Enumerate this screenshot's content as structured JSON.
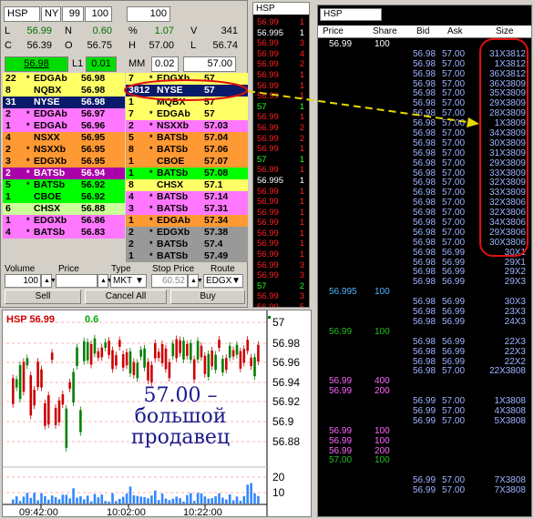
{
  "level2": {
    "symbol": "HSP",
    "exchange": "NY",
    "lot_field": "99",
    "size_field": "100",
    "volume_field": "100",
    "quote": [
      {
        "label": "L",
        "value": "56.99"
      },
      {
        "label": "N",
        "value": "0.60"
      },
      {
        "label": "%",
        "value": "1.07"
      },
      {
        "label": "V",
        "value": "341"
      },
      {
        "label": "C",
        "value": "56.39"
      },
      {
        "label": "O",
        "value": "56.75"
      },
      {
        "label": "H",
        "value": "57.00"
      },
      {
        "label": "L",
        "value": "56.74"
      }
    ],
    "bid_box": "56.98",
    "l1_label": "L1",
    "l1_value": "0.01",
    "mm_label": "MM",
    "mm_value": "0.02",
    "ask_box": "57.00",
    "bids": [
      {
        "size": "22",
        "star": "*",
        "mm": "EDGAb",
        "price": "56.98",
        "color": "#ffff66"
      },
      {
        "size": "8",
        "star": "",
        "mm": "NQBX",
        "price": "56.98",
        "color": "#ffff66"
      },
      {
        "size": "31",
        "star": "",
        "mm": "NYSE",
        "price": "56.98",
        "color": "#0a1a6a"
      },
      {
        "size": "2",
        "star": "*",
        "mm": "EDGAb",
        "price": "56.97",
        "color": "#ff77ff"
      },
      {
        "size": "1",
        "star": "*",
        "mm": "EDGAb",
        "price": "56.96",
        "color": "#ff77ff"
      },
      {
        "size": "4",
        "star": "",
        "mm": "NSXX",
        "price": "56.95",
        "color": "#ff9933"
      },
      {
        "size": "2",
        "star": "*",
        "mm": "NSXXb",
        "price": "56.95",
        "color": "#ff9933"
      },
      {
        "size": "3",
        "star": "*",
        "mm": "EDGXb",
        "price": "56.95",
        "color": "#ff9933"
      },
      {
        "size": "2",
        "star": "*",
        "mm": "BATSb",
        "price": "56.94",
        "color": "#aa00aa"
      },
      {
        "size": "5",
        "star": "*",
        "mm": "BATSb",
        "price": "56.92",
        "color": "#00ff00"
      },
      {
        "size": "1",
        "star": "",
        "mm": "CBOE",
        "price": "56.92",
        "color": "#00ff00"
      },
      {
        "size": "6",
        "star": "",
        "mm": "CHSX",
        "price": "56.88",
        "color": "#ccff99"
      },
      {
        "size": "1",
        "star": "*",
        "mm": "EDGXb",
        "price": "56.86",
        "color": "#ff77ff"
      },
      {
        "size": "4",
        "star": "*",
        "mm": "BATSb",
        "price": "56.83",
        "color": "#ff77ff"
      }
    ],
    "asks": [
      {
        "size": "7",
        "star": "*",
        "mm": "EDGXb",
        "price": "57",
        "color": "#ffff66"
      },
      {
        "size": "3812",
        "star": "",
        "mm": "NYSE",
        "price": "57",
        "color": "#0a1a6a"
      },
      {
        "size": "1",
        "star": "",
        "mm": "MQBX",
        "price": "57",
        "color": "#ffff66"
      },
      {
        "size": "7",
        "star": "*",
        "mm": "EDGAb",
        "price": "57",
        "color": "#ffff66"
      },
      {
        "size": "2",
        "star": "*",
        "mm": "NSXXb",
        "price": "57.03",
        "color": "#ff77ff"
      },
      {
        "size": "5",
        "star": "*",
        "mm": "BATSb",
        "price": "57.04",
        "color": "#ff9933"
      },
      {
        "size": "8",
        "star": "*",
        "mm": "BATSb",
        "price": "57.06",
        "color": "#ff9933"
      },
      {
        "size": "1",
        "star": "",
        "mm": "CBOE",
        "price": "57.07",
        "color": "#ff9933"
      },
      {
        "size": "1",
        "star": "*",
        "mm": "BATSb",
        "price": "57.08",
        "color": "#00ff00"
      },
      {
        "size": "8",
        "star": "",
        "mm": "CHSX",
        "price": "57.1",
        "color": "#ffff66"
      },
      {
        "size": "4",
        "star": "*",
        "mm": "BATSb",
        "price": "57.14",
        "color": "#ff77ff"
      },
      {
        "size": "3",
        "star": "*",
        "mm": "BATSb",
        "price": "57.31",
        "color": "#ff77ff"
      },
      {
        "size": "1",
        "star": "*",
        "mm": "EDGAb",
        "price": "57.34",
        "color": "#ff9933"
      },
      {
        "size": "2",
        "star": "*",
        "mm": "EDGXb",
        "price": "57.38",
        "color": "#999999"
      },
      {
        "size": "2",
        "star": "*",
        "mm": "BATSb",
        "price": "57.4",
        "color": "#999999"
      },
      {
        "size": "1",
        "star": "*",
        "mm": "BATSb",
        "price": "57.49",
        "color": "#999999"
      }
    ],
    "order_entry": {
      "volume_label": "Volume",
      "price_label": "Price",
      "type_label": "Type",
      "stop_price_label": "Stop Price",
      "route_label": "Route",
      "volume_value": "100",
      "price_value": "",
      "type_value": "MKT",
      "stop_price_value": "60.52",
      "route_value": "EDGX",
      "sell": "Sell",
      "cancel_all": "Cancel All",
      "buy": "Buy"
    }
  },
  "chart": {
    "symbol_price": "HSP 56.99",
    "change": "0.6",
    "price_ticks": [
      "57",
      "56.98",
      "56.96",
      "56.94",
      "56.92",
      "56.9",
      "56.88"
    ],
    "volume_ticks": [
      "20",
      "10"
    ],
    "time_ticks": [
      "09:42:00",
      "10:02:00",
      "10:22:00"
    ],
    "annotation_line1": "57.00 –",
    "annotation_line2": "большой",
    "annotation_line3": "продавец",
    "colors": {
      "up": "#008000",
      "down": "#cc0000",
      "volume": "#3388ff",
      "annotation": "#1a1a8c"
    }
  },
  "time_sales_small": {
    "symbol": "HSP",
    "rows": [
      {
        "price": "56.99",
        "size": "1",
        "color": "#ff2020"
      },
      {
        "price": "56.995",
        "size": "1",
        "color": "#ffffff"
      },
      {
        "price": "56.99",
        "size": "3",
        "color": "#ff2020"
      },
      {
        "price": "56.99",
        "size": "4",
        "color": "#ff2020"
      },
      {
        "price": "56.99",
        "size": "2",
        "color": "#ff2020"
      },
      {
        "price": "56.99",
        "size": "1",
        "color": "#ff2020"
      },
      {
        "price": "56.99",
        "size": "1",
        "color": "#ff2020"
      },
      {
        "price": "56.99",
        "size": "1",
        "color": "#ff2020"
      },
      {
        "price": "57",
        "size": "1",
        "color": "#20ff20"
      },
      {
        "price": "56.99",
        "size": "1",
        "color": "#ff2020"
      },
      {
        "price": "56.99",
        "size": "2",
        "color": "#ff2020"
      },
      {
        "price": "56.99",
        "size": "2",
        "color": "#ff2020"
      },
      {
        "price": "56.99",
        "size": "1",
        "color": "#ff2020"
      },
      {
        "price": "57",
        "size": "1",
        "color": "#20ff20"
      },
      {
        "price": "56.99",
        "size": "1",
        "color": "#ff2020"
      },
      {
        "price": "56.995",
        "size": "1",
        "color": "#ffffff"
      },
      {
        "price": "56.99",
        "size": "1",
        "color": "#ff2020"
      },
      {
        "price": "56.99",
        "size": "1",
        "color": "#ff2020"
      },
      {
        "price": "56.99",
        "size": "1",
        "color": "#ff2020"
      },
      {
        "price": "56.99",
        "size": "1",
        "color": "#ff2020"
      },
      {
        "price": "56.99",
        "size": "1",
        "color": "#ff2020"
      },
      {
        "price": "56.99",
        "size": "1",
        "color": "#ff2020"
      },
      {
        "price": "56.99",
        "size": "1",
        "color": "#ff2020"
      },
      {
        "price": "56.99",
        "size": "3",
        "color": "#ff2020"
      },
      {
        "price": "56.99",
        "size": "3",
        "color": "#ff2020"
      },
      {
        "price": "57",
        "size": "2",
        "color": "#20ff20"
      },
      {
        "price": "56.99",
        "size": "3",
        "color": "#ff2020"
      },
      {
        "price": "56.99",
        "size": "5",
        "color": "#ff2020"
      }
    ]
  },
  "time_sales_big": {
    "symbol": "HSP",
    "headers": [
      "Price",
      "Share",
      "Bid",
      "Ask",
      "Size"
    ],
    "rows": [
      {
        "price": "56.99",
        "share": "100",
        "bid": "",
        "ask": "",
        "size": "",
        "color": "#ffffff"
      },
      {
        "price": "",
        "share": "",
        "bid": "56.98",
        "ask": "57.00",
        "size": "31X3812",
        "color": "#9fb4ff"
      },
      {
        "price": "",
        "share": "",
        "bid": "56.98",
        "ask": "57.00",
        "size": "1X3812",
        "color": "#9fb4ff"
      },
      {
        "price": "",
        "share": "",
        "bid": "56.98",
        "ask": "57.00",
        "size": "36X3812",
        "color": "#9fb4ff"
      },
      {
        "price": "",
        "share": "",
        "bid": "56.98",
        "ask": "57.00",
        "size": "36X3809",
        "color": "#9fb4ff"
      },
      {
        "price": "",
        "share": "",
        "bid": "56.98",
        "ask": "57.00",
        "size": "35X3809",
        "color": "#9fb4ff"
      },
      {
        "price": "",
        "share": "",
        "bid": "56.98",
        "ask": "57.00",
        "size": "29X3809",
        "color": "#9fb4ff"
      },
      {
        "price": "",
        "share": "",
        "bid": "56.98",
        "ask": "57.00",
        "size": "28X3809",
        "color": "#9fb4ff"
      },
      {
        "price": "",
        "share": "",
        "bid": "56.98",
        "ask": "57.00",
        "size": "1X3809",
        "color": "#9fb4ff"
      },
      {
        "price": "",
        "share": "",
        "bid": "56.98",
        "ask": "57.00",
        "size": "34X3809",
        "color": "#9fb4ff"
      },
      {
        "price": "",
        "share": "",
        "bid": "56.98",
        "ask": "57.00",
        "size": "30X3809",
        "color": "#9fb4ff"
      },
      {
        "price": "",
        "share": "",
        "bid": "56.98",
        "ask": "57.00",
        "size": "31X3809",
        "color": "#9fb4ff"
      },
      {
        "price": "",
        "share": "",
        "bid": "56.98",
        "ask": "57.00",
        "size": "29X3809",
        "color": "#9fb4ff"
      },
      {
        "price": "",
        "share": "",
        "bid": "56.98",
        "ask": "57.00",
        "size": "33X3809",
        "color": "#9fb4ff"
      },
      {
        "price": "",
        "share": "",
        "bid": "56.98",
        "ask": "57.00",
        "size": "32X3809",
        "color": "#9fb4ff"
      },
      {
        "price": "",
        "share": "",
        "bid": "56.98",
        "ask": "57.00",
        "size": "33X3809",
        "color": "#9fb4ff"
      },
      {
        "price": "",
        "share": "",
        "bid": "56.98",
        "ask": "57.00",
        "size": "32X3806",
        "color": "#9fb4ff"
      },
      {
        "price": "",
        "share": "",
        "bid": "56.98",
        "ask": "57.00",
        "size": "32X3806",
        "color": "#9fb4ff"
      },
      {
        "price": "",
        "share": "",
        "bid": "56.98",
        "ask": "57.00",
        "size": "34X3806",
        "color": "#9fb4ff"
      },
      {
        "price": "",
        "share": "",
        "bid": "56.98",
        "ask": "57.00",
        "size": "29X3806",
        "color": "#9fb4ff"
      },
      {
        "price": "",
        "share": "",
        "bid": "56.98",
        "ask": "57.00",
        "size": "30X3806",
        "color": "#9fb4ff"
      },
      {
        "price": "",
        "share": "",
        "bid": "56.98",
        "ask": "56.99",
        "size": "30X1",
        "color": "#9fb4ff"
      },
      {
        "price": "",
        "share": "",
        "bid": "56.98",
        "ask": "56.99",
        "size": "29X1",
        "color": "#9fb4ff"
      },
      {
        "price": "",
        "share": "",
        "bid": "56.98",
        "ask": "56.99",
        "size": "29X2",
        "color": "#9fb4ff"
      },
      {
        "price": "",
        "share": "",
        "bid": "56.98",
        "ask": "56.99",
        "size": "29X3",
        "color": "#9fb4ff"
      },
      {
        "price": "56.995",
        "share": "100",
        "bid": "",
        "ask": "",
        "size": "",
        "color": "#4fb6ff"
      },
      {
        "price": "",
        "share": "",
        "bid": "56.98",
        "ask": "56.99",
        "size": "30X3",
        "color": "#9fb4ff"
      },
      {
        "price": "",
        "share": "",
        "bid": "56.98",
        "ask": "56.99",
        "size": "23X3",
        "color": "#9fb4ff"
      },
      {
        "price": "",
        "share": "",
        "bid": "56.98",
        "ask": "56.99",
        "size": "24X3",
        "color": "#9fb4ff"
      },
      {
        "price": "56.99",
        "share": "100",
        "bid": "",
        "ask": "",
        "size": "",
        "color": "#20c020"
      },
      {
        "price": "",
        "share": "",
        "bid": "56.98",
        "ask": "56.99",
        "size": "22X3",
        "color": "#9fb4ff"
      },
      {
        "price": "",
        "share": "",
        "bid": "56.98",
        "ask": "56.99",
        "size": "22X3",
        "color": "#9fb4ff"
      },
      {
        "price": "",
        "share": "",
        "bid": "56.98",
        "ask": "56.99",
        "size": "22X2",
        "color": "#9fb4ff"
      },
      {
        "price": "",
        "share": "",
        "bid": "56.98",
        "ask": "57.00",
        "size": "22X3808",
        "color": "#9fb4ff"
      },
      {
        "price": "56.99",
        "share": "400",
        "bid": "",
        "ask": "",
        "size": "",
        "color": "#ff66ff"
      },
      {
        "price": "56.99",
        "share": "200",
        "bid": "",
        "ask": "",
        "size": "",
        "color": "#ff66ff"
      },
      {
        "price": "",
        "share": "",
        "bid": "56.99",
        "ask": "57.00",
        "size": "1X3808",
        "color": "#9fb4ff"
      },
      {
        "price": "",
        "share": "",
        "bid": "56.99",
        "ask": "57.00",
        "size": "4X3808",
        "color": "#9fb4ff"
      },
      {
        "price": "",
        "share": "",
        "bid": "56.99",
        "ask": "57.00",
        "size": "5X3808",
        "color": "#9fb4ff"
      },
      {
        "price": "56.99",
        "share": "100",
        "bid": "",
        "ask": "",
        "size": "",
        "color": "#ff66ff"
      },
      {
        "price": "56.99",
        "share": "100",
        "bid": "",
        "ask": "",
        "size": "",
        "color": "#ff66ff"
      },
      {
        "price": "56.99",
        "share": "200",
        "bid": "",
        "ask": "",
        "size": "",
        "color": "#ff66ff"
      },
      {
        "price": "57.00",
        "share": "100",
        "bid": "",
        "ask": "",
        "size": "",
        "color": "#20c020"
      },
      {
        "price": "",
        "share": "",
        "bid": "",
        "ask": "",
        "size": "",
        "color": "#9fb4ff"
      },
      {
        "price": "",
        "share": "",
        "bid": "56.99",
        "ask": "57.00",
        "size": "7X3808",
        "color": "#9fb4ff"
      },
      {
        "price": "",
        "share": "",
        "bid": "56.99",
        "ask": "57.00",
        "size": "7X3808",
        "color": "#9fb4ff"
      }
    ]
  },
  "colors": {
    "highlight_oval": "#e01010",
    "arrow": "#e8d800",
    "window_bg": "#d4d0c8"
  }
}
